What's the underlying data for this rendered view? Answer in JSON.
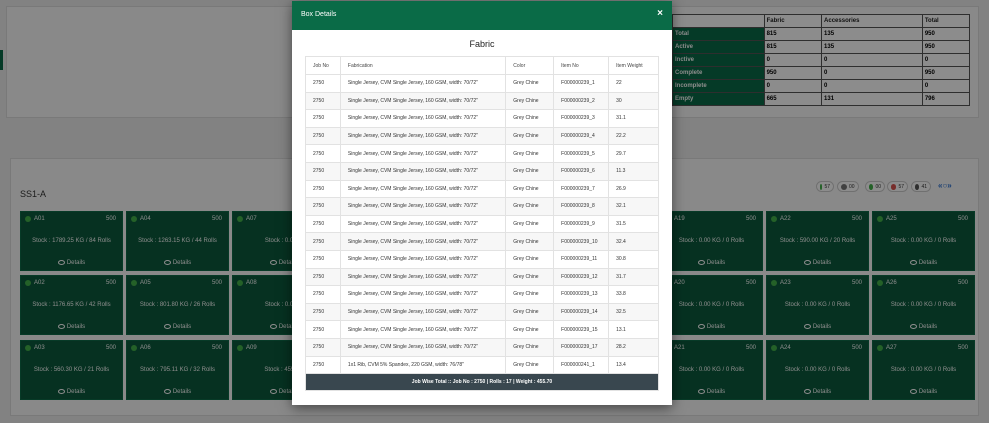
{
  "summary_table": {
    "headers": [
      "",
      "Fabric",
      "Accessories",
      "Total"
    ],
    "rows": [
      {
        "label": "Total",
        "fabric": "815",
        "accessories": "135",
        "total": "950"
      },
      {
        "label": "Active",
        "fabric": "815",
        "accessories": "135",
        "total": "950"
      },
      {
        "label": "Inctive",
        "fabric": "0",
        "accessories": "0",
        "total": "0"
      },
      {
        "label": "Complete",
        "fabric": "950",
        "accessories": "0",
        "total": "950"
      },
      {
        "label": "Incomplete",
        "fabric": "0",
        "accessories": "0",
        "total": "0"
      },
      {
        "label": "Empty",
        "fabric": "665",
        "accessories": "131",
        "total": "796"
      }
    ]
  },
  "section": {
    "title": "SS1-A",
    "legend": [
      {
        "count": "57",
        "color": "#43b14a"
      },
      {
        "count": "00",
        "color": "#777777"
      },
      {
        "count": "00",
        "color": "#43b14a"
      },
      {
        "count": "57",
        "color": "#d9534f"
      },
      {
        "count": "41",
        "color": "#555555"
      }
    ],
    "pager": "«○»"
  },
  "cards": [
    {
      "code": "A01",
      "capacity": "500",
      "stock": "Stock : 1789.25 KG / 84 Rolls",
      "details": "Details"
    },
    {
      "code": "A04",
      "capacity": "500",
      "stock": "Stock : 1263.15 KG / 44 Rolls",
      "details": "Details"
    },
    {
      "code": "A07",
      "capacity": "",
      "stock": "Stock : 0.00 K",
      "details": "Details"
    },
    {
      "code": "A19",
      "capacity": "500",
      "stock": "Stock : 0.00 KG / 0 Rolls",
      "details": "Details"
    },
    {
      "code": "A22",
      "capacity": "500",
      "stock": "Stock : 590.00 KG / 20 Rolls",
      "details": "Details"
    },
    {
      "code": "A25",
      "capacity": "500",
      "stock": "Stock : 0.00 KG / 0 Rolls",
      "details": "Details"
    },
    {
      "code": "A02",
      "capacity": "500",
      "stock": "Stock : 1176.65 KG / 42 Rolls",
      "details": "Details"
    },
    {
      "code": "A05",
      "capacity": "500",
      "stock": "Stock : 801.80 KG / 26 Rolls",
      "details": "Details"
    },
    {
      "code": "A08",
      "capacity": "",
      "stock": "Stock : 0.00 K",
      "details": "Details"
    },
    {
      "code": "A20",
      "capacity": "500",
      "stock": "Stock : 0.00 KG / 0 Rolls",
      "details": "Details"
    },
    {
      "code": "A23",
      "capacity": "500",
      "stock": "Stock : 0.00 KG / 0 Rolls",
      "details": "Details"
    },
    {
      "code": "A26",
      "capacity": "500",
      "stock": "Stock : 0.00 KG / 0 Rolls",
      "details": "Details"
    },
    {
      "code": "A03",
      "capacity": "500",
      "stock": "Stock : 560.30 KG / 21 Rolls",
      "details": "Details"
    },
    {
      "code": "A06",
      "capacity": "500",
      "stock": "Stock : 795.11 KG / 32 Rolls",
      "details": "Details"
    },
    {
      "code": "A09",
      "capacity": "",
      "stock": "Stock : 455.70",
      "details": "Details"
    },
    {
      "code": "A21",
      "capacity": "500",
      "stock": "Stock : 0.00 KG / 0 Rolls",
      "details": "Details"
    },
    {
      "code": "A24",
      "capacity": "500",
      "stock": "Stock : 0.00 KG / 0 Rolls",
      "details": "Details"
    },
    {
      "code": "A27",
      "capacity": "500",
      "stock": "Stock : 0.00 KG / 0 Rolls",
      "details": "Details"
    }
  ],
  "modal": {
    "title": "Box Details",
    "close": "×",
    "subtitle": "Fabric",
    "columns": [
      "Job No",
      "Fabrication",
      "Color",
      "Item No",
      "Item Weight"
    ],
    "rows": [
      [
        "2750",
        "Single Jersey, CVM Single Jersey, 160 GSM, width: 70/72\"",
        "Grey Chine",
        "F000000239_1",
        "22"
      ],
      [
        "2750",
        "Single Jersey, CVM Single Jersey, 160 GSM, width: 70/72\"",
        "Grey Chine",
        "F000000239_2",
        "30"
      ],
      [
        "2750",
        "Single Jersey, CVM Single Jersey, 160 GSM, width: 70/72\"",
        "Grey Chine",
        "F000000239_3",
        "31.1"
      ],
      [
        "2750",
        "Single Jersey, CVM Single Jersey, 160 GSM, width: 70/72\"",
        "Grey Chine",
        "F000000239_4",
        "22.2"
      ],
      [
        "2750",
        "Single Jersey, CVM Single Jersey, 160 GSM, width: 70/72\"",
        "Grey Chine",
        "F000000239_5",
        "29.7"
      ],
      [
        "2750",
        "Single Jersey, CVM Single Jersey, 160 GSM, width: 70/72\"",
        "Grey Chine",
        "F000000239_6",
        "11.3"
      ],
      [
        "2750",
        "Single Jersey, CVM Single Jersey, 160 GSM, width: 70/72\"",
        "Grey Chine",
        "F000000239_7",
        "26.9"
      ],
      [
        "2750",
        "Single Jersey, CVM Single Jersey, 160 GSM, width: 70/72\"",
        "Grey Chine",
        "F000000239_8",
        "32.1"
      ],
      [
        "2750",
        "Single Jersey, CVM Single Jersey, 160 GSM, width: 70/72\"",
        "Grey Chine",
        "F000000239_9",
        "31.5"
      ],
      [
        "2750",
        "Single Jersey, CVM Single Jersey, 160 GSM, width: 70/72\"",
        "Grey Chine",
        "F000000239_10",
        "32.4"
      ],
      [
        "2750",
        "Single Jersey, CVM Single Jersey, 160 GSM, width: 70/72\"",
        "Grey Chine",
        "F000000239_11",
        "30.8"
      ],
      [
        "2750",
        "Single Jersey, CVM Single Jersey, 160 GSM, width: 70/72\"",
        "Grey Chine",
        "F000000239_12",
        "31.7"
      ],
      [
        "2750",
        "Single Jersey, CVM Single Jersey, 160 GSM, width: 70/72\"",
        "Grey Chine",
        "F000000239_13",
        "33.8"
      ],
      [
        "2750",
        "Single Jersey, CVM Single Jersey, 160 GSM, width: 70/72\"",
        "Grey Chine",
        "F000000239_14",
        "32.5"
      ],
      [
        "2750",
        "Single Jersey, CVM Single Jersey, 160 GSM, width: 70/72\"",
        "Grey Chine",
        "F000000239_15",
        "13.1"
      ],
      [
        "2750",
        "Single Jersey, CVM Single Jersey, 160 GSM, width: 70/72\"",
        "Grey Chine",
        "F000000239_17",
        "28.2"
      ],
      [
        "2750",
        "1x1 Rib, CVM 5% Spandex, 220 GSM, width: 76/78\"",
        "Grey Chine",
        "F000000241_1",
        "13.4"
      ]
    ],
    "footer": "Job Wise Total :: Job No : 2750   |   Rolls : 17 |   Weight : 455.70"
  }
}
